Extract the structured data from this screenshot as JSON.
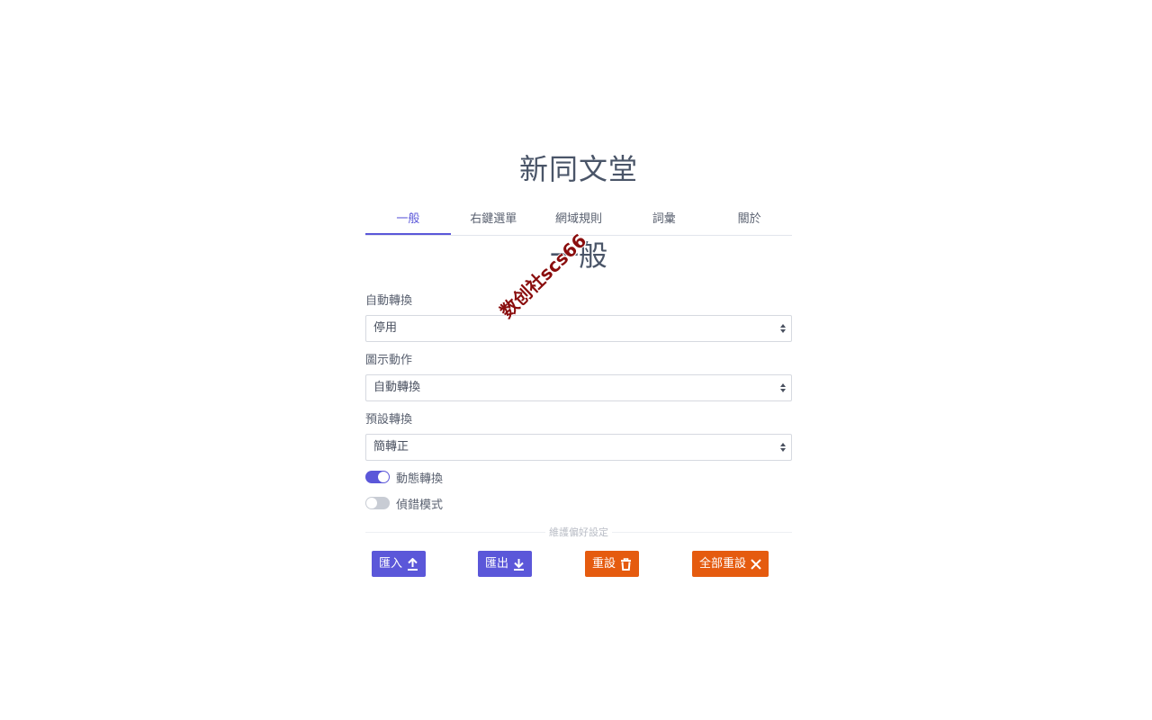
{
  "app": {
    "title": "新同文堂"
  },
  "tabs": [
    {
      "label": "一般",
      "active": true
    },
    {
      "label": "右鍵選單",
      "active": false
    },
    {
      "label": "網域規則",
      "active": false
    },
    {
      "label": "詞彙",
      "active": false
    },
    {
      "label": "關於",
      "active": false
    }
  ],
  "section": {
    "title": "一般"
  },
  "fields": {
    "auto_convert": {
      "label": "自動轉換",
      "value": "停用"
    },
    "icon_action": {
      "label": "圖示動作",
      "value": "自動轉換"
    },
    "default_convert": {
      "label": "預設轉換",
      "value": "簡轉正"
    }
  },
  "toggles": {
    "dynamic_convert": {
      "label": "動態轉換",
      "on": true
    },
    "debug_mode": {
      "label": "偵錯模式",
      "on": false
    }
  },
  "maintenance": {
    "divider_label": "維護偏好設定",
    "import_label": "匯入",
    "export_label": "匯出",
    "reset_label": "重設",
    "reset_all_label": "全部重設"
  },
  "watermark": {
    "text": "数创社scs66"
  },
  "colors": {
    "accent": "#5b57d9",
    "danger": "#e55b0f"
  }
}
